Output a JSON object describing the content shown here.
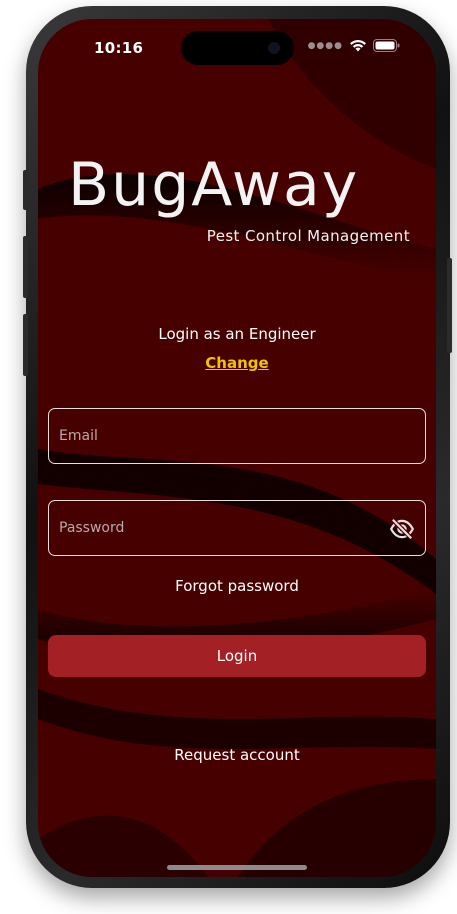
{
  "status_bar": {
    "time": "10:16",
    "signal_icon": "cellular-signal-icon",
    "wifi_icon": "wifi-icon",
    "battery_icon": "battery-icon"
  },
  "logo": {
    "title": "BugAway",
    "subtitle": "Pest Control Management"
  },
  "login": {
    "role_text": "Login as an Engineer",
    "change_label": "Change",
    "email_placeholder": "Email",
    "password_placeholder": "Password",
    "password_toggle_icon": "eye-off-icon",
    "forgot_label": "Forgot password",
    "login_label": "Login",
    "request_label": "Request account"
  },
  "colors": {
    "background": "#470000",
    "button": "#a32124",
    "link": "#f2c200",
    "text": "#ffffff"
  }
}
